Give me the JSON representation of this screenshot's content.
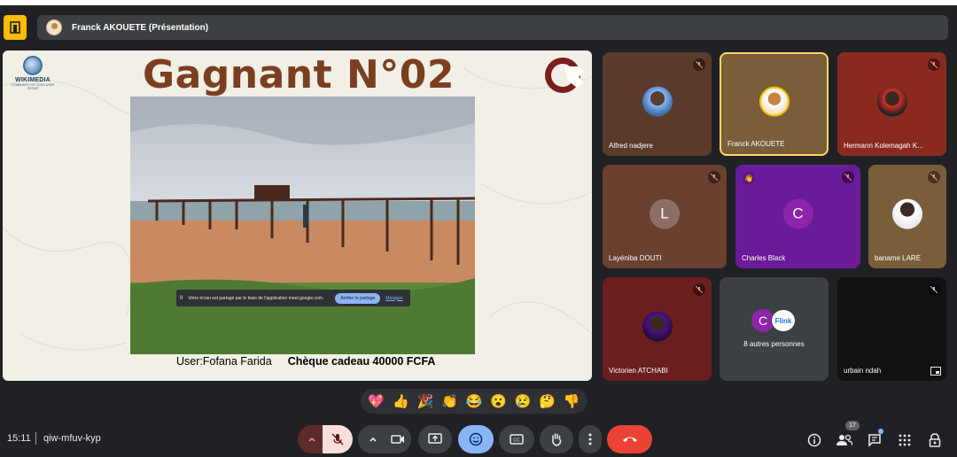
{
  "header": {
    "presenter_label": "Franck AKOUETE (Présentation)"
  },
  "slide": {
    "logo_name": "WIKIMEDIA",
    "logo_sub": "COMMUNITY OF TOGO USER GROUP",
    "title": "Gagnant N°02",
    "caption_user": "User:Fofana Farida",
    "caption_prize": "Chèque cadeau 40000 FCFA",
    "share_message": "Votre écran est partagé par le biais de l'application meet.google.com.",
    "share_stop": "Arrêter le partage",
    "share_hide": "Masquer"
  },
  "participants": [
    {
      "name": "Alfred nadjere",
      "muted": true,
      "bg": "#5a3a2a"
    },
    {
      "name": "Franck AKOUETE",
      "muted": false,
      "bg": "#7a5e3a",
      "active": true
    },
    {
      "name": "Hermann Kolemagah K...",
      "muted": true,
      "bg": "#8a2a1e"
    },
    {
      "name": "Layéniba DOUTI",
      "muted": true,
      "bg": "#6a4030",
      "letter": "L",
      "letter_color": "#8d6e63"
    },
    {
      "name": "Charles Black",
      "muted": true,
      "bg": "#6a1b9a",
      "letter": "C",
      "letter_color": "#8e24aa",
      "hand_raised": true
    },
    {
      "name": "baname LARE",
      "muted": true,
      "bg": "#7a5e3a"
    },
    {
      "name": "Victorien ATCHABI",
      "muted": true,
      "bg": "#6a1e1e"
    },
    {
      "name": "urbain ndah",
      "muted": true,
      "bg": "#111111"
    }
  ],
  "others": {
    "label": "8 autres personnes",
    "letter": "C",
    "letter_color": "#8e24aa",
    "logo_text": "Flink"
  },
  "reactions": [
    "💖",
    "👍",
    "🎉",
    "👏",
    "😂",
    "😮",
    "😢",
    "🤔",
    "👎"
  ],
  "bottom": {
    "time": "15:11",
    "meeting_code": "qiw-mfuv-kyp",
    "participant_count": "17"
  },
  "colors": {
    "accent_yellow": "#fbbc04",
    "mic_off_bg": "#f9dedc",
    "end_call": "#ea4335",
    "reaction_active": "#8ab4f8"
  }
}
